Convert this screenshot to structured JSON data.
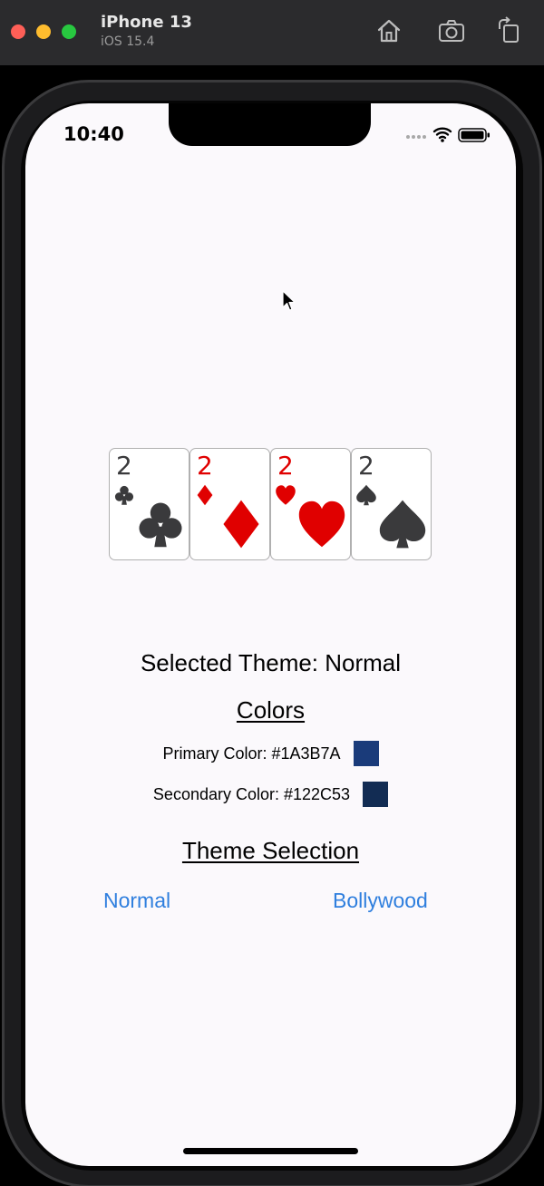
{
  "window": {
    "device_name": "iPhone 13",
    "os_version": "iOS 15.4",
    "icons": [
      "home-icon",
      "screenshot-icon",
      "rotate-icon"
    ]
  },
  "status_bar": {
    "time": "10:40",
    "icons": [
      "signal-icon",
      "wifi-icon",
      "battery-icon"
    ]
  },
  "cards": [
    {
      "rank": "2",
      "suit": "clubs",
      "color": "#3a3a3c"
    },
    {
      "rank": "2",
      "suit": "diamonds",
      "color": "#e00000"
    },
    {
      "rank": "2",
      "suit": "hearts",
      "color": "#e00000"
    },
    {
      "rank": "2",
      "suit": "spades",
      "color": "#3a3a3c"
    }
  ],
  "theme": {
    "selected_label": "Selected Theme: Normal",
    "colors_heading": "Colors",
    "primary_label": "Primary Color: #1A3B7A",
    "primary_hex": "#1A3B7A",
    "secondary_label": "Secondary Color: #122C53",
    "secondary_hex": "#122C53",
    "selection_heading": "Theme Selection",
    "options": [
      "Normal",
      "Bollywood"
    ],
    "link_color": "#2f7fde"
  }
}
